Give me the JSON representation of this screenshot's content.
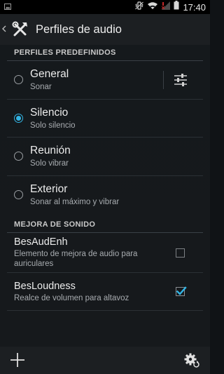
{
  "status_bar": {
    "time": "17:40",
    "icons": [
      "image-notification-icon",
      "vibrate-icon",
      "wifi-icon",
      "no-signal-icon",
      "battery-icon"
    ]
  },
  "action_bar": {
    "title": "Perfiles de audio",
    "icon": "tools-icon"
  },
  "sections": {
    "predefined": {
      "header": "PERFILES PREDEFINIDOS",
      "profiles": [
        {
          "title": "General",
          "subtitle": "Sonar",
          "selected": false
        },
        {
          "title": "Silencio",
          "subtitle": "Solo silencio",
          "selected": true
        },
        {
          "title": "Reunión",
          "subtitle": "Solo vibrar",
          "selected": false
        },
        {
          "title": "Exterior",
          "subtitle": "Sonar al máximo y vibrar",
          "selected": false
        }
      ]
    },
    "enhancement": {
      "header": "MEJORA DE SONIDO",
      "options": [
        {
          "title": "BesAudEnh",
          "subtitle": "Elemento de mejora de audio para auriculares",
          "checked": false
        },
        {
          "title": "BesLoudness",
          "subtitle": "Realce de volumen para altavoz",
          "checked": true
        }
      ]
    }
  },
  "bottom_bar": {
    "add_icon": "plus-icon",
    "settings_icon": "gear-reset-icon"
  },
  "colors": {
    "accent": "#33b5e5",
    "background": "#15191c",
    "bar": "#1c1f22"
  }
}
